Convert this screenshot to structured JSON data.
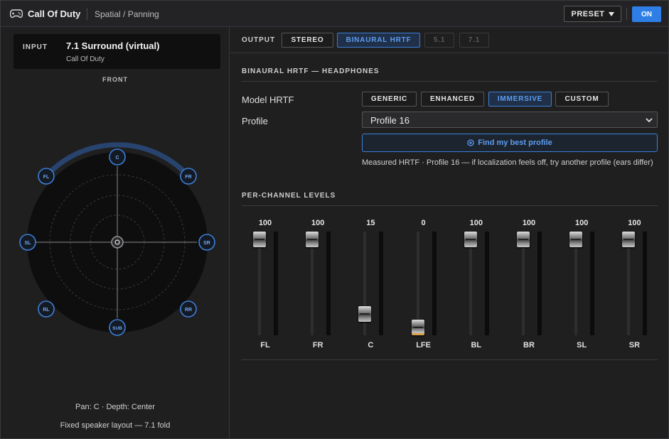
{
  "titlebar": {
    "app_title": "Call Of Duty",
    "breadcrumb": "Spatial / Panning",
    "preset_label": "PRESET",
    "on_label": "ON"
  },
  "input": {
    "label": "INPUT",
    "title": "7.1 Surround (virtual)",
    "subtitle": "Call Of Duty"
  },
  "panner": {
    "front_label": "FRONT",
    "speakers": [
      "C",
      "FL",
      "FR",
      "SL",
      "SR",
      "RL",
      "RR",
      "SUB"
    ],
    "pan_info": "Pan: C · Depth: Center",
    "layout_info": "Fixed speaker layout — 7.1 fold",
    "accent": "#2f7ee6"
  },
  "output": {
    "label": "OUTPUT",
    "modes": [
      "STEREO",
      "BINAURAL HRTF",
      "5.1",
      "7.1"
    ],
    "active_mode": "BINAURAL HRTF"
  },
  "hrtf": {
    "section_title": "BINAURAL HRTF — HEADPHONES",
    "model_label": "Model HRTF",
    "models": [
      "GENERIC",
      "ENHANCED",
      "IMMERSIVE",
      "CUSTOM"
    ],
    "active_model": "IMMERSIVE",
    "profile_label": "Profile",
    "profile_value": "Profile 16",
    "find_label": "Find my best profile",
    "note": "Measured HRTF · Profile 16 — if localization feels off, try another profile (ears differ)"
  },
  "levels": {
    "section_title": "PER-CHANNEL LEVELS",
    "channels": [
      {
        "name": "FL",
        "value": "100"
      },
      {
        "name": "FR",
        "value": "100"
      },
      {
        "name": "C",
        "value": "15"
      },
      {
        "name": "LFE",
        "value": "0"
      },
      {
        "name": "BL",
        "value": "100"
      },
      {
        "name": "BR",
        "value": "100"
      },
      {
        "name": "SL",
        "value": "100"
      },
      {
        "name": "SR",
        "value": "100"
      }
    ]
  }
}
